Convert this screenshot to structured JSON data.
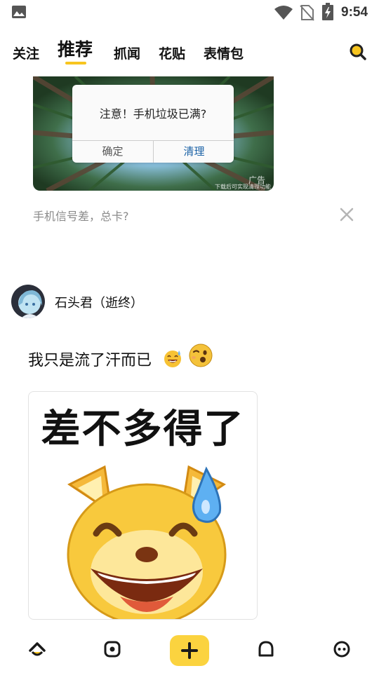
{
  "status_bar": {
    "time": "9:54",
    "icons": [
      "photo-icon",
      "wifi-icon",
      "sim-blocked-icon",
      "battery-charging-icon"
    ]
  },
  "tabs": [
    {
      "label": "关注",
      "active": false
    },
    {
      "label": "推荐",
      "active": true
    },
    {
      "label": "抓闻",
      "active": false
    },
    {
      "label": "花贴",
      "active": false
    },
    {
      "label": "表情包",
      "active": false
    }
  ],
  "colors": {
    "accent": "#f7c51f",
    "post_button_bg": "#fbd33f",
    "dialog_clean": "#1b62a6",
    "caption_gray": "#8a8a8a"
  },
  "ad": {
    "dialog_message": "注意！手机垃圾已满?",
    "confirm_label": "确定",
    "clean_label": "清理",
    "ad_label": "广告",
    "ad_note": "下载后可实现清理功能",
    "caption": "手机信号差，总卡?"
  },
  "post": {
    "username": "石头君（逝终）",
    "text": "我只是流了汗而已",
    "emojis": [
      "sweat-smile-emoji",
      "wink-emoji"
    ],
    "image_caption": "差不多得了"
  },
  "bottom_nav": [
    {
      "name": "home",
      "icon": "home-icon",
      "active": true
    },
    {
      "name": "discover",
      "icon": "discover-icon",
      "active": false
    },
    {
      "name": "post",
      "icon": "plus-icon",
      "active": false
    },
    {
      "name": "messages",
      "icon": "bell-icon",
      "active": false
    },
    {
      "name": "profile",
      "icon": "profile-face-icon",
      "active": false
    }
  ]
}
